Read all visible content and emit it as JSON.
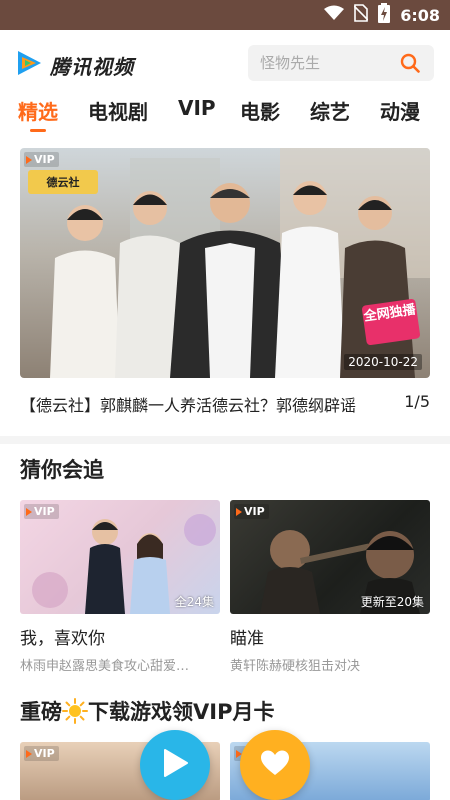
{
  "status_bar": {
    "time": "6:08",
    "icons": [
      "wifi-icon",
      "no-sim-icon",
      "battery-charging-icon"
    ]
  },
  "header": {
    "logo_text": "腾讯视频",
    "search": {
      "placeholder": "怪物先生"
    }
  },
  "tabs": [
    {
      "label": "精选",
      "active": true
    },
    {
      "label": "电视剧"
    },
    {
      "label": "VIP"
    },
    {
      "label": "电影"
    },
    {
      "label": "综艺"
    },
    {
      "label": "动漫"
    }
  ],
  "banner": {
    "vip_badge": "VIP",
    "show_logo": "德云社",
    "exclusive_tag": "全网独播",
    "date": "2020-10-22",
    "caption": "【德云社】郭麒麟一人养活德云社？郭德纲辟谣",
    "index": "1/5"
  },
  "guess_section": {
    "title": "猜你会追",
    "cards": [
      {
        "vip": "VIP",
        "episodes": "全24集",
        "title": "我，喜欢你",
        "subtitle": "林雨申赵露思美食攻心甜爱…"
      },
      {
        "vip": "VIP",
        "episodes": "更新至20集",
        "title": "瞄准",
        "subtitle": "黄轩陈赫硬核狙击对决"
      }
    ]
  },
  "promo_section": {
    "title_before": "重磅",
    "title_after": "下载游戏领VIP月卡",
    "cards": [
      {
        "vip": "VIP"
      },
      {
        "vip": "VIP"
      }
    ]
  },
  "colors": {
    "accent": "#ff6a1a",
    "status_bar": "#6b4a3e",
    "play_fab": "#29b6e8",
    "fav_fab": "#ffb020"
  }
}
